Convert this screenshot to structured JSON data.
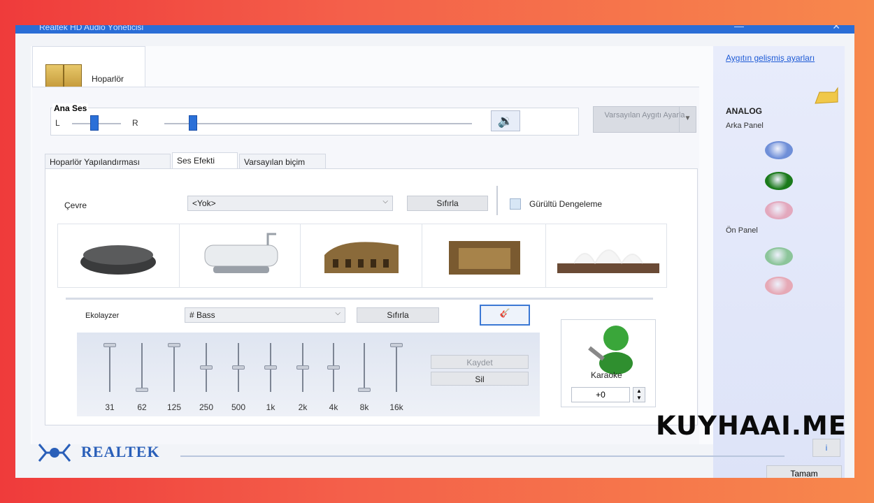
{
  "window": {
    "title": "Realtek HD Audio Yöneticisi",
    "close": "✕",
    "minimize": "—"
  },
  "device_tab": {
    "label": "Hoparlör"
  },
  "master_volume": {
    "title": "Ana Ses",
    "left": "L",
    "right": "R",
    "balance": 0.45,
    "level": 0.08
  },
  "default_device_button": {
    "label": "Varsayılan Aygıtı Ayarla"
  },
  "tabs": [
    "Hoparlör Yapılandırması",
    "Ses Efekti",
    "Varsayılan biçim"
  ],
  "active_tab": "Ses Efekti",
  "environment": {
    "label": "Çevre",
    "value": "<Yok>",
    "reset": "Sıfırla",
    "noise_label": "Gürültü Dengeleme"
  },
  "equalizer": {
    "label": "Ekolayzer",
    "preset": "# Bass",
    "reset": "Sıfırla",
    "save": "Kaydet",
    "delete": "Sil",
    "bands": [
      {
        "f": "31",
        "v": 1.0
      },
      {
        "f": "62",
        "v": 0.0
      },
      {
        "f": "125",
        "v": 1.0
      },
      {
        "f": "250",
        "v": 0.5
      },
      {
        "f": "500",
        "v": 0.5
      },
      {
        "f": "1k",
        "v": 0.5
      },
      {
        "f": "2k",
        "v": 0.5
      },
      {
        "f": "4k",
        "v": 0.5
      },
      {
        "f": "8k",
        "v": 0.0
      },
      {
        "f": "16k",
        "v": 1.0
      }
    ]
  },
  "karaoke": {
    "label": "Karaoke",
    "value": "+0"
  },
  "sidebar": {
    "link": "Aygıtın gelişmiş ayarları",
    "analog": "ANALOG",
    "rear": "Arka Panel",
    "front": "Ön Panel",
    "colors": {
      "blue": "#6f8fd8",
      "green": "#1b7a1b",
      "pink": "#e3a8bd",
      "fgreen": "#8cc59a",
      "fpink": "#e6a9b6"
    }
  },
  "footer": {
    "brand": "REALTEK",
    "ok": "Tamam",
    "info": "i"
  },
  "watermark": "KUYHAAI.ME"
}
